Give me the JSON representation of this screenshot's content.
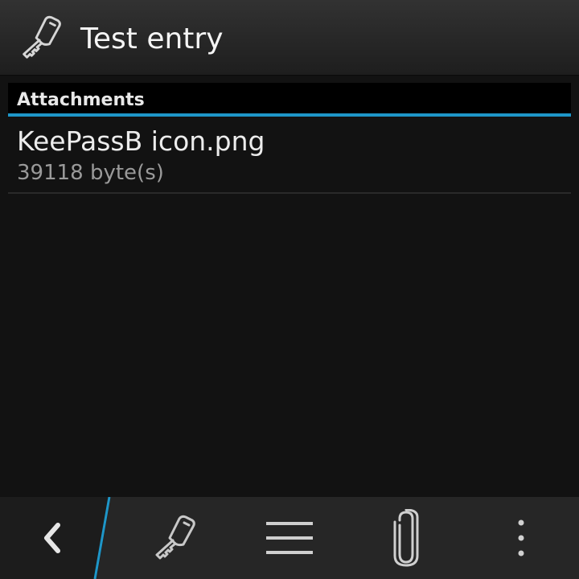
{
  "titlebar": {
    "icon": "key-icon",
    "title": "Test entry"
  },
  "section": {
    "header": "Attachments"
  },
  "attachments": [
    {
      "name": "KeePassB icon.png",
      "size": "39118 byte(s)"
    }
  ],
  "actionbar": {
    "items": [
      {
        "icon": "back-icon"
      },
      {
        "icon": "key-icon"
      },
      {
        "icon": "menu-icon"
      },
      {
        "icon": "paperclip-icon"
      },
      {
        "icon": "more-icon"
      }
    ]
  },
  "colors": {
    "accent": "#1e96c8",
    "background": "#121212",
    "titlebar": "#2a2a2a",
    "actionbar": "#262626"
  }
}
